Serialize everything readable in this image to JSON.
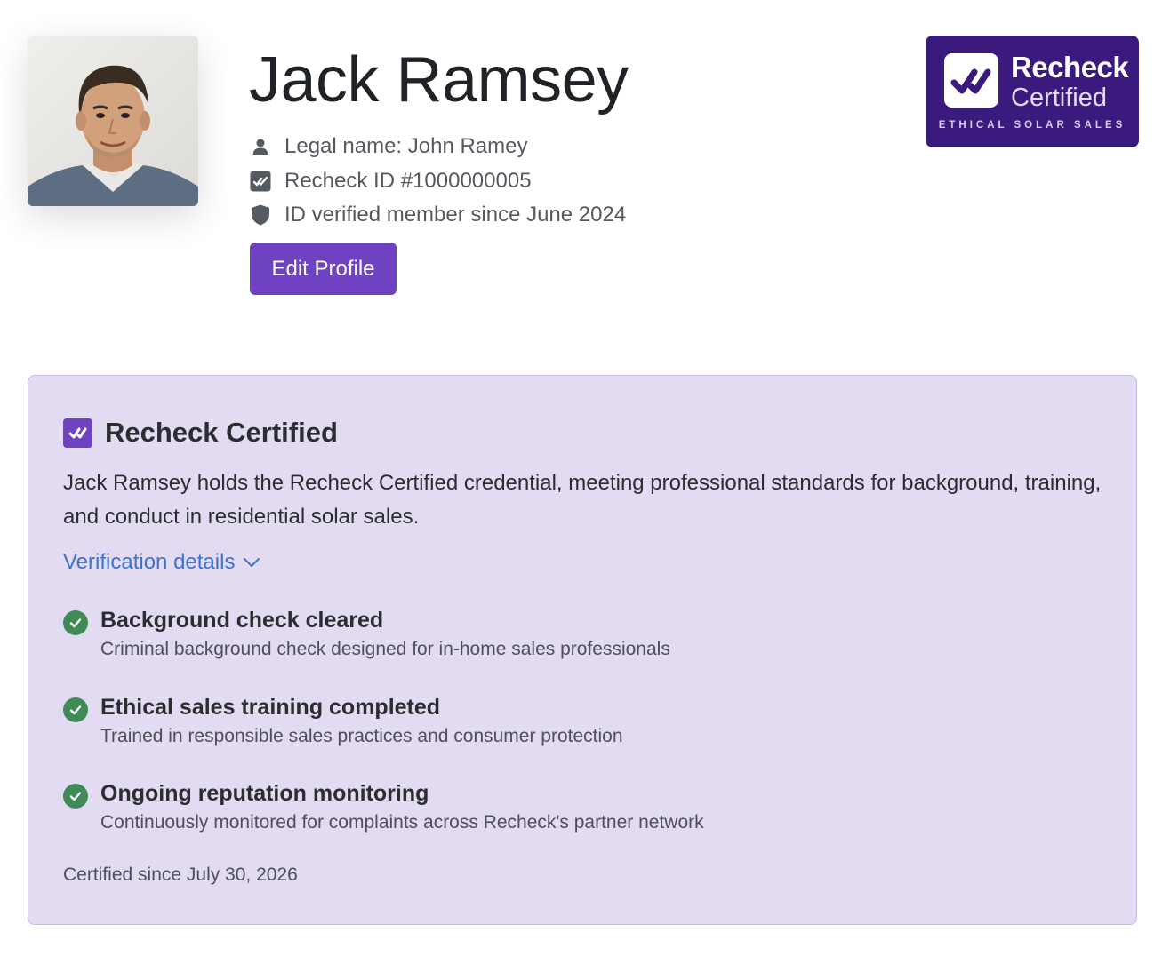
{
  "profile": {
    "name": "Jack Ramsey",
    "legal_name": "Legal name: John Ramey",
    "recheck_id": "Recheck ID #1000000005",
    "verified_since": "ID verified member since June 2024",
    "edit_button": "Edit Profile",
    "avatar_alt": "Profile photo of Jack Ramsey",
    "icons": [
      "person-icon",
      "recheck-check-icon",
      "shield-icon"
    ]
  },
  "badge": {
    "title": "Recheck",
    "subtitle": "Certified",
    "tagline": "ETHICAL SOLAR SALES",
    "background_color": "#3a1a7d"
  },
  "certification": {
    "title": "Recheck Certified",
    "description": "Jack Ramsey holds the Recheck Certified credential, meeting professional standards for background, training, and conduct in residential solar sales.",
    "details_link": "Verification details",
    "items": [
      {
        "title": "Background check cleared",
        "description": "Criminal background check designed for in-home sales professionals"
      },
      {
        "title": "Ethical sales training completed",
        "description": "Trained in responsible sales practices and consumer protection"
      },
      {
        "title": "Ongoing reputation monitoring",
        "description": "Continuously monitored for complaints across Recheck's partner network"
      }
    ],
    "certified_since": "Certified since July 30, 2026",
    "card_background": "#e2dbf2"
  },
  "colors": {
    "accent": "#6f42c1",
    "link": "#3f72cc",
    "success": "#3f8a56"
  }
}
